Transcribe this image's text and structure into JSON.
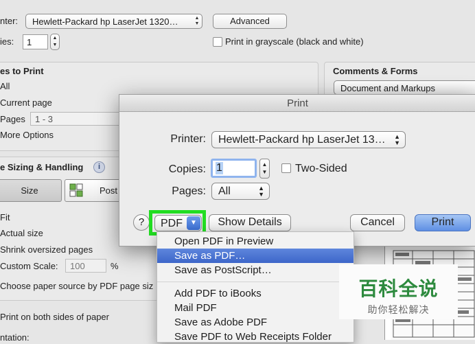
{
  "background": {
    "printer_label": "nter:",
    "printer_value": "Hewlett-Packard hp LaserJet 1320…",
    "advanced_button": "Advanced",
    "copies_label": "ies:",
    "copies_value": "1",
    "grayscale_label": "Print in grayscale (black and white)",
    "pages_to_print": "es to Print",
    "opt_all": "All",
    "opt_current": "Current page",
    "opt_pages": "Pages",
    "pages_range": "1 - 3",
    "opt_more": "More Options",
    "comments_forms": "Comments & Forms",
    "comments_value": "Document and Markups",
    "page_sizing": "e Sizing & Handling",
    "size_button": "Size",
    "poster_button": "Post",
    "fit": "Fit",
    "actual_size": "Actual size",
    "shrink": "Shrink oversized pages",
    "custom_scale": "Custom Scale:",
    "custom_scale_value": "100",
    "percent": "%",
    "paper_source": "Choose paper source by PDF page siz",
    "both_sides": "Print on both sides of paper",
    "orientation": "ntation:"
  },
  "dialog": {
    "title": "Print",
    "printer_label": "Printer:",
    "printer_value": "Hewlett-Packard hp LaserJet 13…",
    "copies_label": "Copies:",
    "copies_value": "1",
    "two_sided_label": "Two-Sided",
    "pages_label": "Pages:",
    "pages_value": "All",
    "help": "?",
    "pdf_button": "PDF",
    "show_details": "Show Details",
    "cancel": "Cancel",
    "print": "Print"
  },
  "pdf_menu": {
    "items": [
      "Open PDF in Preview",
      "Save as PDF…",
      "Save as PostScript…",
      "Add PDF to iBooks",
      "Mail PDF",
      "Save as Adobe PDF",
      "Save PDF to Web Receipts Folder"
    ],
    "selected_index": 1
  },
  "watermark": {
    "title": "百科全说",
    "subtitle": "助你轻松解决"
  },
  "colors": {
    "highlight": "#3f68cb",
    "print_button": "#6f9ce6",
    "pdf_outline": "#22dd22",
    "watermark_green": "#2d8a3e"
  }
}
